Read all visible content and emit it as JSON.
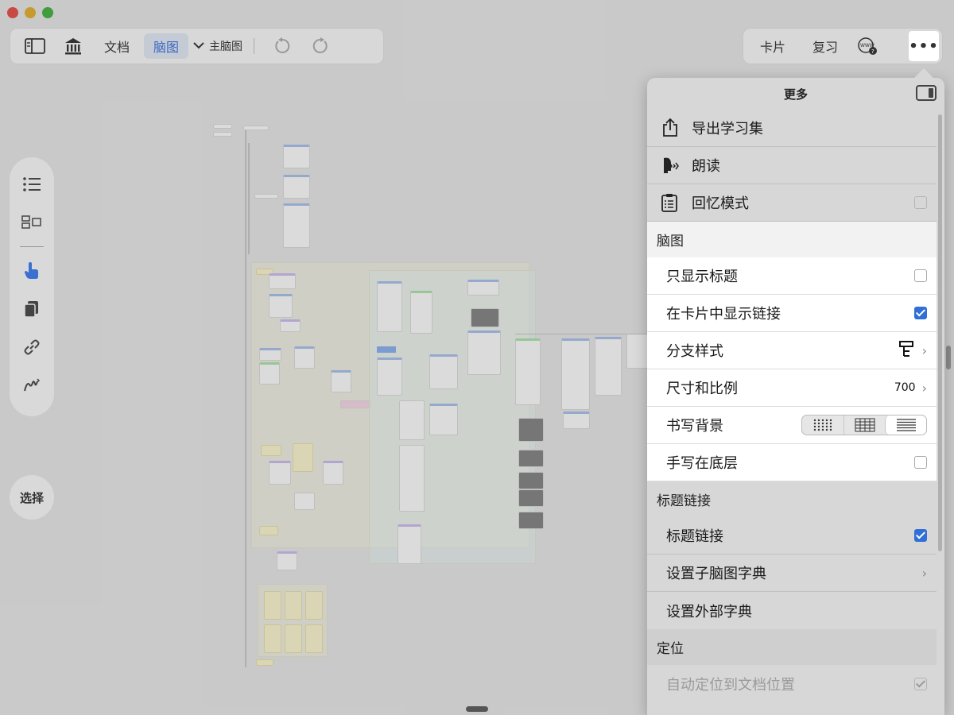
{
  "toolbar": {
    "documents_label": "文档",
    "mindmap_label": "脑图",
    "main_map_label": "主脑图",
    "cards_label": "卡片",
    "review_label": "复习",
    "more_label": "•••"
  },
  "rail": {
    "select_label": "选择"
  },
  "panel": {
    "title": "更多",
    "export_label": "导出学习集",
    "read_aloud_label": "朗读",
    "recall_mode_label": "回忆模式",
    "recall_mode_checked": false,
    "mindmap_section": "脑图",
    "titles_only_label": "只显示标题",
    "titles_only_checked": false,
    "show_links_label": "在卡片中显示链接",
    "show_links_checked": true,
    "branch_style_label": "分支样式",
    "size_ratio_label": "尺寸和比例",
    "size_ratio_value": "700",
    "writing_bg_label": "书写背景",
    "writing_bg_options": [
      "dots",
      "grid",
      "lines"
    ],
    "writing_bg_selected": "lines",
    "handwriting_bottom_label": "手写在底层",
    "handwriting_bottom_checked": false,
    "title_links_section": "标题链接",
    "title_links_label": "标题链接",
    "title_links_checked": true,
    "sub_dict_label": "设置子脑图字典",
    "external_dict_label": "设置外部字典",
    "locate_section": "定位",
    "auto_locate_label": "自动定位到文档位置",
    "auto_locate_checked": true
  }
}
